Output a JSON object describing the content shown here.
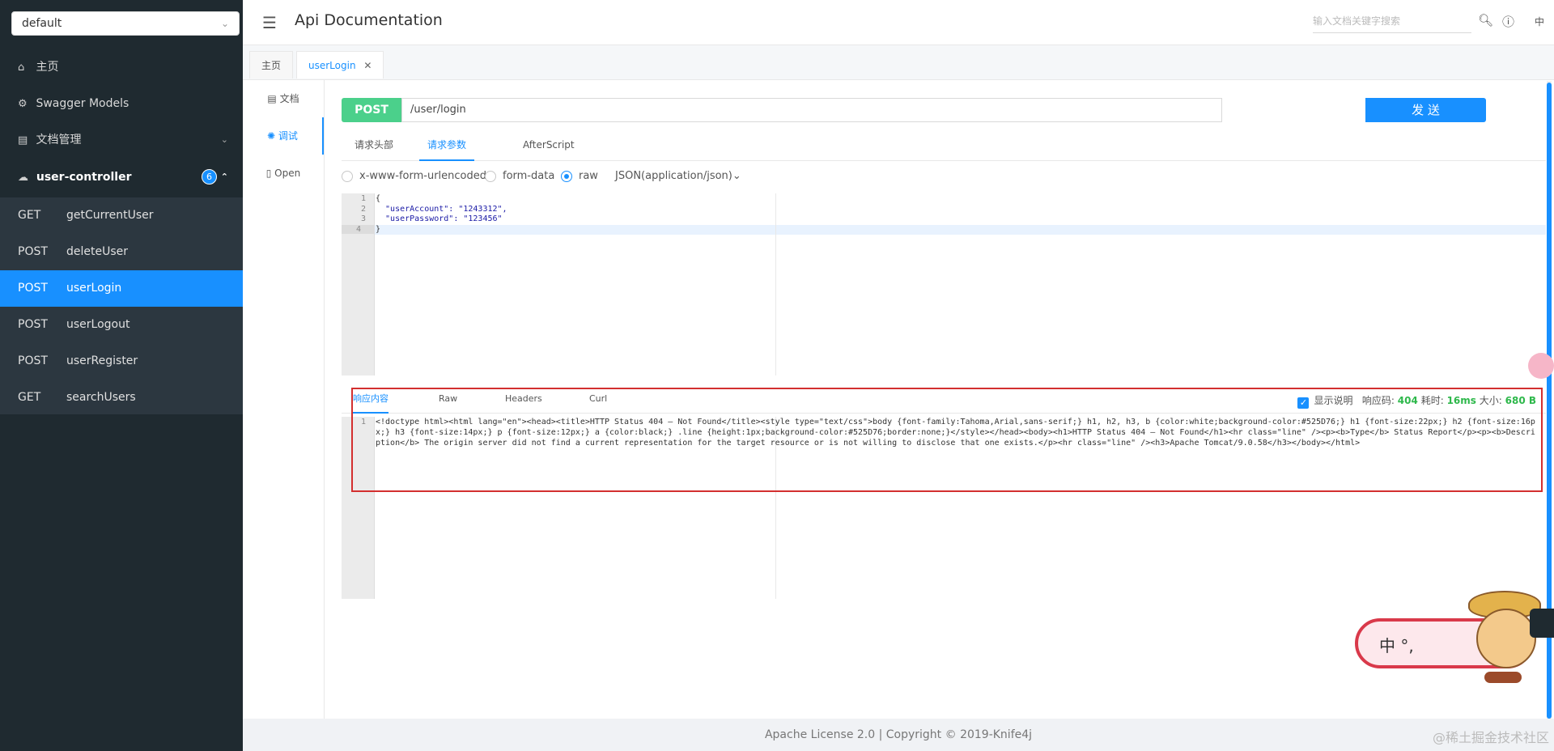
{
  "sidebar": {
    "group_select": "default",
    "menu": [
      {
        "label": "主页",
        "icon": "home-icon"
      },
      {
        "label": "Swagger Models",
        "icon": "models-icon"
      },
      {
        "label": "文档管理",
        "icon": "docs-icon"
      }
    ],
    "controller": {
      "label": "user-controller",
      "count": "6"
    },
    "apis": [
      {
        "method": "GET",
        "name": "getCurrentUser"
      },
      {
        "method": "POST",
        "name": "deleteUser"
      },
      {
        "method": "POST",
        "name": "userLogin"
      },
      {
        "method": "POST",
        "name": "userLogout"
      },
      {
        "method": "POST",
        "name": "userRegister"
      },
      {
        "method": "GET",
        "name": "searchUsers"
      }
    ]
  },
  "header": {
    "title": "Api Documentation",
    "search_placeholder": "输入文档关键字搜索",
    "lang": "中"
  },
  "tabs": [
    {
      "label": "主页"
    },
    {
      "label": "userLogin"
    }
  ],
  "vnav": [
    {
      "label": "文档"
    },
    {
      "label": "调试"
    },
    {
      "label": "Open"
    }
  ],
  "request": {
    "method": "POST",
    "url": "/user/login",
    "send_label": "发 送",
    "subtabs": [
      "请求头部",
      "请求参数",
      "AfterScript"
    ],
    "body_types": [
      "x-www-form-urlencoded",
      "form-data",
      "raw"
    ],
    "content_type": "JSON(application/json)",
    "body_lines": [
      "{",
      "  \"userAccount\": \"1243312\",",
      "  \"userPassword\": \"123456\"",
      "}"
    ],
    "line_numbers": [
      "1",
      "2",
      "3",
      "4"
    ]
  },
  "response": {
    "tabs": [
      "响应内容",
      "Raw",
      "Headers",
      "Curl"
    ],
    "show_desc_label": "显示说明",
    "status_label": "响应码:",
    "status": "404",
    "time_label": "耗时:",
    "time": "16ms",
    "size_label": "大小:",
    "size": "680 B",
    "line_number": "1",
    "body": "<!doctype html><html lang=\"en\"><head><title>HTTP Status 404 – Not Found</title><style type=\"text/css\">body {font-family:Tahoma,Arial,sans-serif;} h1, h2, h3, b {color:white;background-color:#525D76;} h1 {font-size:22px;} h2 {font-size:16px;} h3 {font-size:14px;} p {font-size:12px;} a {color:black;} .line {height:1px;background-color:#525D76;border:none;}</style></head><body><h1>HTTP Status 404 – Not Found</h1><hr class=\"line\" /><p><b>Type</b> Status Report</p><p><b>Description</b> The origin server did not find a current representation for the target resource or is not willing to disclose that one exists.</p><hr class=\"line\" /><h3>Apache Tomcat/9.0.58</h3></body></html>"
  },
  "footer": {
    "text": "Apache License 2.0 | Copyright © 2019-Knife4j",
    "watermark": "@稀土掘金技术社区"
  },
  "mascot": {
    "text": "中 °,"
  }
}
